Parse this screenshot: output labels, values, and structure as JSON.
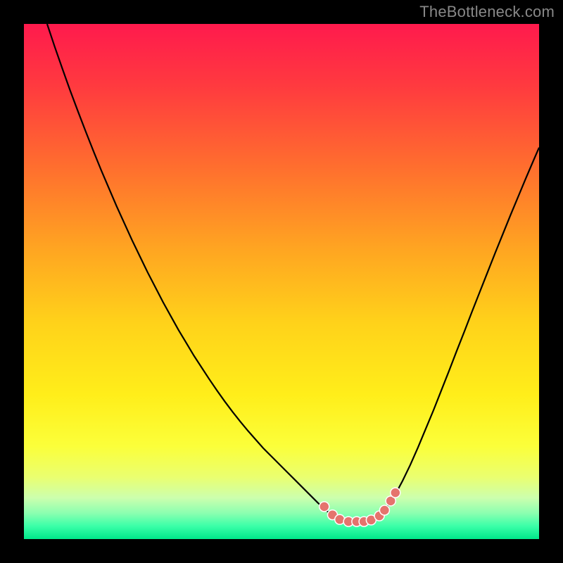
{
  "watermark": {
    "text": "TheBottleneck.com"
  },
  "chart_data": {
    "type": "line",
    "title": "",
    "xlabel": "",
    "ylabel": "",
    "xlim": [
      0,
      1
    ],
    "ylim": [
      0,
      1
    ],
    "gradient_stops": [
      {
        "offset": 0.0,
        "color": "#ff1a4d"
      },
      {
        "offset": 0.12,
        "color": "#ff3a3f"
      },
      {
        "offset": 0.28,
        "color": "#ff6f2e"
      },
      {
        "offset": 0.44,
        "color": "#ffa621"
      },
      {
        "offset": 0.58,
        "color": "#ffd21a"
      },
      {
        "offset": 0.72,
        "color": "#ffee1a"
      },
      {
        "offset": 0.82,
        "color": "#fbff3a"
      },
      {
        "offset": 0.88,
        "color": "#eaff70"
      },
      {
        "offset": 0.92,
        "color": "#ccffae"
      },
      {
        "offset": 0.95,
        "color": "#8affb0"
      },
      {
        "offset": 0.975,
        "color": "#3affa8"
      },
      {
        "offset": 1.0,
        "color": "#00e88a"
      }
    ],
    "series": [
      {
        "name": "bottleneck-curve",
        "color": "#000000",
        "x": [
          0.045,
          0.06,
          0.075,
          0.09,
          0.105,
          0.12,
          0.135,
          0.15,
          0.165,
          0.18,
          0.195,
          0.21,
          0.225,
          0.24,
          0.255,
          0.27,
          0.285,
          0.3,
          0.315,
          0.33,
          0.345,
          0.36,
          0.375,
          0.39,
          0.405,
          0.42,
          0.435,
          0.45,
          0.465,
          0.48,
          0.495,
          0.51,
          0.525,
          0.54,
          0.555,
          0.57,
          0.585,
          0.6,
          0.615,
          0.63,
          0.645,
          0.66,
          0.675,
          0.69,
          0.705,
          0.72,
          0.735,
          0.75,
          0.765,
          0.78,
          0.795,
          0.81,
          0.825,
          0.84,
          0.855,
          0.87,
          0.885,
          0.9,
          0.915,
          0.93,
          0.945,
          0.96,
          0.975,
          0.99,
          1.0
        ],
        "y": [
          1.0,
          0.955,
          0.912,
          0.87,
          0.83,
          0.791,
          0.753,
          0.716,
          0.681,
          0.646,
          0.613,
          0.58,
          0.549,
          0.518,
          0.489,
          0.46,
          0.433,
          0.406,
          0.381,
          0.356,
          0.333,
          0.31,
          0.288,
          0.267,
          0.247,
          0.228,
          0.21,
          0.193,
          0.176,
          0.161,
          0.146,
          0.131,
          0.116,
          0.101,
          0.086,
          0.071,
          0.057,
          0.045,
          0.037,
          0.035,
          0.035,
          0.035,
          0.037,
          0.046,
          0.062,
          0.085,
          0.113,
          0.144,
          0.178,
          0.214,
          0.25,
          0.288,
          0.326,
          0.365,
          0.403,
          0.442,
          0.48,
          0.518,
          0.556,
          0.593,
          0.63,
          0.666,
          0.702,
          0.737,
          0.76
        ]
      }
    ],
    "markers": {
      "name": "highlight-dots",
      "color": "#e5736d",
      "points": [
        {
          "x": 0.583,
          "y": 0.063
        },
        {
          "x": 0.599,
          "y": 0.047
        },
        {
          "x": 0.613,
          "y": 0.038
        },
        {
          "x": 0.63,
          "y": 0.034
        },
        {
          "x": 0.646,
          "y": 0.034
        },
        {
          "x": 0.66,
          "y": 0.034
        },
        {
          "x": 0.674,
          "y": 0.037
        },
        {
          "x": 0.69,
          "y": 0.045
        },
        {
          "x": 0.7,
          "y": 0.056
        },
        {
          "x": 0.712,
          "y": 0.074
        },
        {
          "x": 0.721,
          "y": 0.09
        }
      ]
    }
  }
}
